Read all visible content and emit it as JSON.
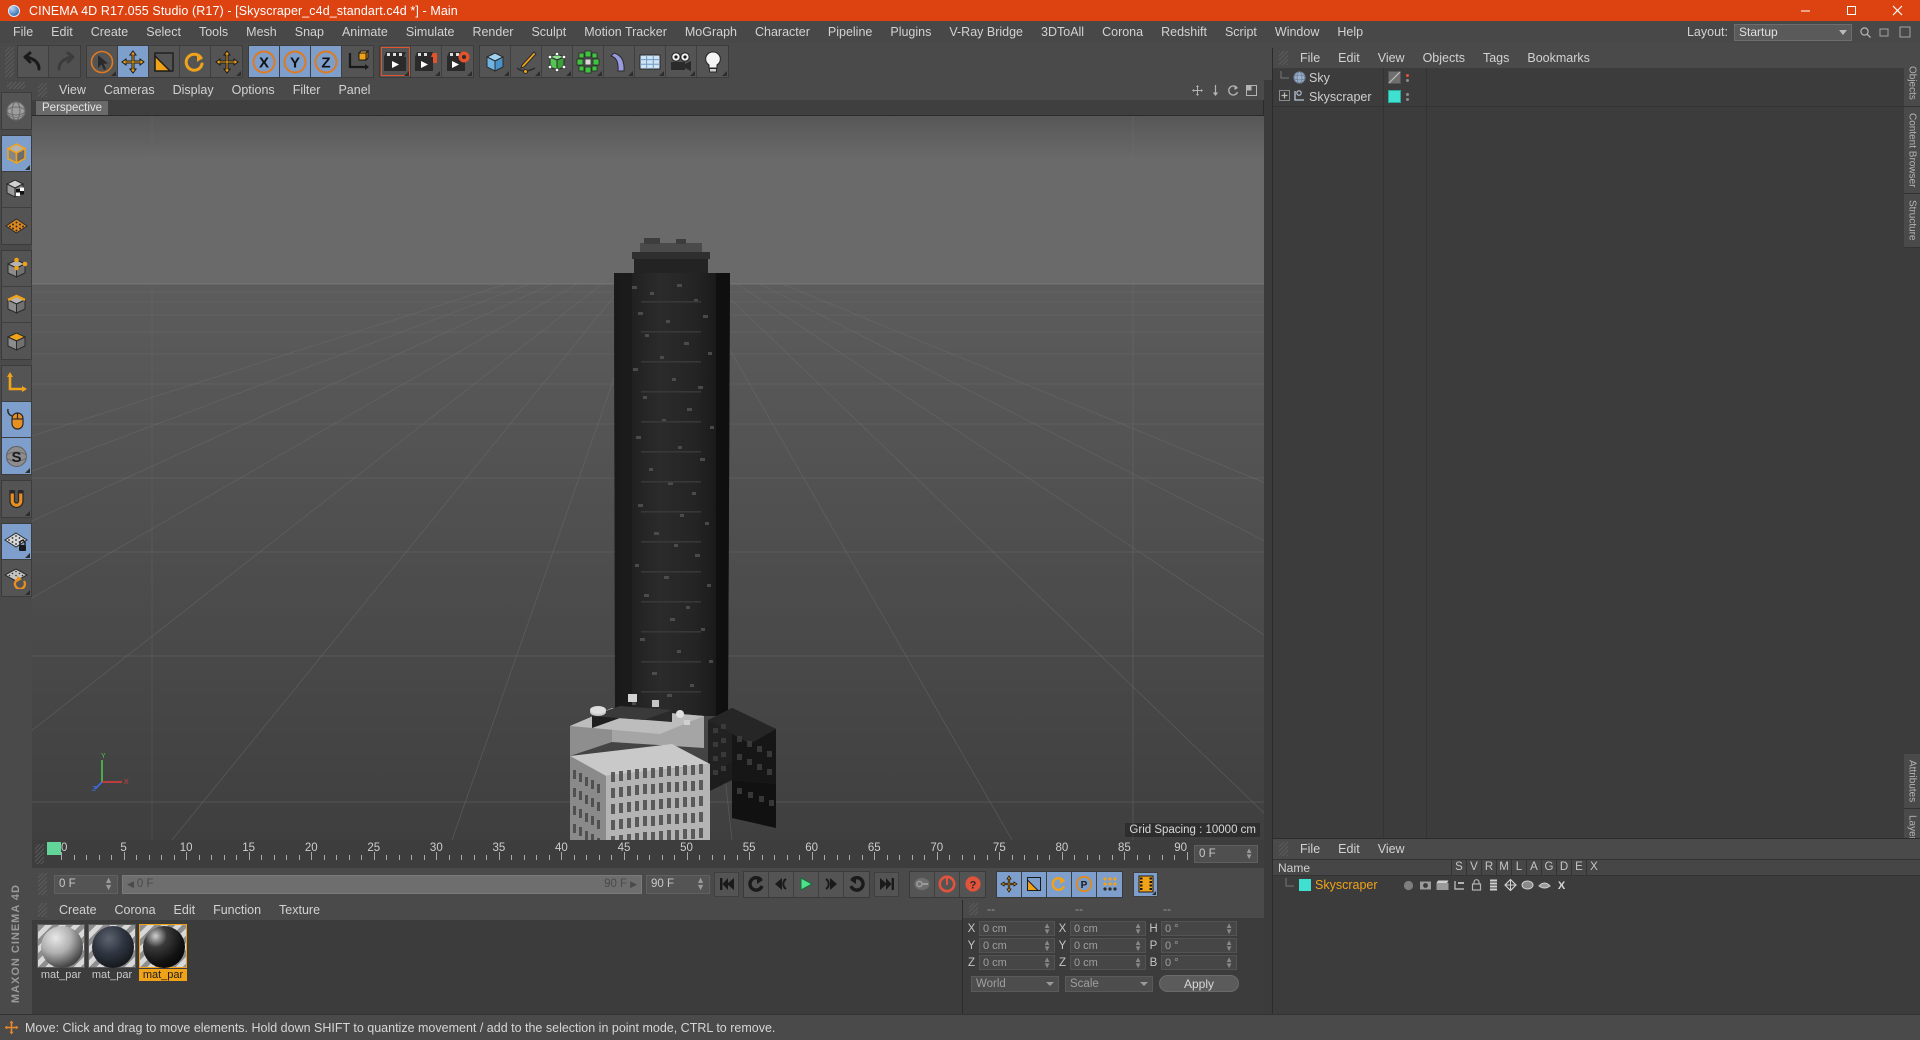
{
  "window": {
    "title": "CINEMA 4D R17.055 Studio (R17) - [Skyscraper_c4d_standart.c4d *] - Main",
    "app_icon": "cinema4d-globe-icon",
    "minimize": "—",
    "maximize": "□",
    "close": "✕"
  },
  "menubar": {
    "items": [
      {
        "label": "File"
      },
      {
        "label": "Edit"
      },
      {
        "label": "Create"
      },
      {
        "label": "Select"
      },
      {
        "label": "Tools"
      },
      {
        "label": "Mesh"
      },
      {
        "label": "Snap"
      },
      {
        "label": "Animate"
      },
      {
        "label": "Simulate"
      },
      {
        "label": "Render"
      },
      {
        "label": "Sculpt"
      },
      {
        "label": "Motion Tracker"
      },
      {
        "label": "MoGraph"
      },
      {
        "label": "Character"
      },
      {
        "label": "Pipeline"
      },
      {
        "label": "Plugins"
      },
      {
        "label": "V-Ray Bridge"
      },
      {
        "label": "3DToAll"
      },
      {
        "label": "Corona"
      },
      {
        "label": "Redshift"
      },
      {
        "label": "Script"
      },
      {
        "label": "Window"
      },
      {
        "label": "Help"
      }
    ],
    "layout_label": "Layout:",
    "layout_value": "Startup",
    "search_icon": "search-icon"
  },
  "toolbar": {
    "groups": [
      {
        "name": "history",
        "buttons": [
          {
            "name": "undo-button",
            "icon": "undo-arrow-icon",
            "selected": false,
            "dim": false
          },
          {
            "name": "redo-button",
            "icon": "redo-arrow-icon",
            "selected": false,
            "dim": true
          }
        ]
      },
      {
        "name": "transform",
        "buttons": [
          {
            "name": "select-tool-button",
            "icon": "cursor-circle-icon",
            "selected": false,
            "dim": false
          },
          {
            "name": "move-tool-button",
            "icon": "move-arrows-icon",
            "selected": true,
            "dim": false
          },
          {
            "name": "scale-tool-button",
            "icon": "scale-box-icon",
            "selected": false,
            "dim": false
          },
          {
            "name": "rotate-tool-button",
            "icon": "rotate-circle-icon",
            "selected": false,
            "dim": false
          },
          {
            "name": "move-duplicate-button",
            "icon": "move-arrows-icon",
            "selected": false,
            "dim": false
          }
        ]
      },
      {
        "name": "axis-locks",
        "buttons": [
          {
            "name": "lock-x-axis-button",
            "icon": "x-axis-icon",
            "selected": true,
            "dim": false
          },
          {
            "name": "lock-y-axis-button",
            "icon": "y-axis-icon",
            "selected": true,
            "dim": false
          },
          {
            "name": "lock-z-axis-button",
            "icon": "z-axis-icon",
            "selected": true,
            "dim": false
          },
          {
            "name": "world-coordinate-button",
            "icon": "world-axis-cube-icon",
            "selected": false,
            "dim": false
          }
        ]
      },
      {
        "name": "render",
        "buttons": [
          {
            "name": "render-view-button",
            "icon": "clapper-play-icon",
            "selected": false,
            "dim": false
          },
          {
            "name": "render-region-button",
            "icon": "clapper-region-icon",
            "selected": false,
            "dim": false
          },
          {
            "name": "render-settings-button",
            "icon": "clapper-gear-icon",
            "selected": false,
            "dim": false
          }
        ]
      },
      {
        "name": "objects",
        "buttons": [
          {
            "name": "add-cube-button",
            "icon": "blue-cube-icon",
            "selected": false,
            "dim": false
          },
          {
            "name": "add-spline-button",
            "icon": "pen-spline-icon",
            "selected": false,
            "dim": false
          },
          {
            "name": "add-generator-button",
            "icon": "green-cube-icon",
            "selected": false,
            "dim": false
          },
          {
            "name": "add-mograph-button",
            "icon": "mograph-cloner-icon",
            "selected": false,
            "dim": false
          },
          {
            "name": "add-deformer-button",
            "icon": "bend-deformer-icon",
            "selected": false,
            "dim": false
          },
          {
            "name": "add-scene-button",
            "icon": "floor-grid-icon",
            "selected": false,
            "dim": false
          },
          {
            "name": "add-camera-button",
            "icon": "camera-icon",
            "selected": false,
            "dim": false
          },
          {
            "name": "add-light-button",
            "icon": "light-bulb-icon",
            "selected": false,
            "dim": false
          }
        ]
      }
    ]
  },
  "left_palette": {
    "groups": [
      {
        "buttons": [
          {
            "name": "undo-view-button",
            "icon": "globe-wireframe-icon",
            "selected": false
          }
        ]
      },
      {
        "buttons": [
          {
            "name": "model-mode-button",
            "icon": "model-cube-icon",
            "selected": true
          },
          {
            "name": "texture-mode-button",
            "icon": "texture-cube-icon",
            "selected": false
          },
          {
            "name": "workplane-mode-button",
            "icon": "workplane-grid-icon",
            "selected": false
          }
        ]
      },
      {
        "buttons": [
          {
            "name": "points-mode-button",
            "icon": "point-cube-icon",
            "selected": false
          },
          {
            "name": "edges-mode-button",
            "icon": "edge-cube-icon",
            "selected": false
          },
          {
            "name": "polygons-mode-button",
            "icon": "polygon-cube-icon",
            "selected": false
          }
        ]
      },
      {
        "buttons": [
          {
            "name": "axis-mode-button",
            "icon": "axis-arrows-icon",
            "selected": false
          },
          {
            "name": "viewport-solo-button",
            "icon": "mouse-icon",
            "selected": true
          },
          {
            "name": "soft-selection-button",
            "icon": "s-disc-icon",
            "selected": true
          }
        ]
      },
      {
        "buttons": [
          {
            "name": "magnet-button",
            "icon": "magnet-icon",
            "selected": false
          }
        ]
      },
      {
        "buttons": [
          {
            "name": "workplane-lock-button",
            "icon": "grid-lock-icon",
            "selected": true
          },
          {
            "name": "workplane-rotate-button",
            "icon": "grid-rotate-icon",
            "selected": false
          }
        ]
      }
    ],
    "brand_text": "MAXON CINEMA 4D"
  },
  "viewport": {
    "menu": [
      {
        "label": "View"
      },
      {
        "label": "Cameras"
      },
      {
        "label": "Display"
      },
      {
        "label": "Options"
      },
      {
        "label": "Filter"
      },
      {
        "label": "Panel"
      }
    ],
    "tab_label": "Perspective",
    "grid_spacing": "Grid Spacing : 10000 cm",
    "axis": {
      "x": "X",
      "y": "Y",
      "z": "Z"
    },
    "corner_icons": [
      "pan-icon",
      "move-y-icon",
      "rotate-icon",
      "maximize-view-icon"
    ]
  },
  "object_manager": {
    "menu": [
      {
        "label": "File"
      },
      {
        "label": "Edit"
      },
      {
        "label": "View"
      },
      {
        "label": "Objects"
      },
      {
        "label": "Tags"
      },
      {
        "label": "Bookmarks"
      }
    ],
    "rows": [
      {
        "name": "Sky",
        "icon": "sky-sphere-icon",
        "tag_color": "#6f6f6f",
        "has_expand": false,
        "dot_red": true
      },
      {
        "name": "Skyscraper",
        "icon": "null-object-icon",
        "tag_color": "#3fe0d0",
        "has_expand": true,
        "dot_red": false
      }
    ]
  },
  "edge_tabs_top": [
    {
      "label": "Objects"
    },
    {
      "label": "Content Browser"
    },
    {
      "label": "Structure"
    }
  ],
  "edge_tabs_bottom": [
    {
      "label": "Attributes"
    },
    {
      "label": "Layers"
    }
  ],
  "timeline": {
    "labels": [
      "0",
      "5",
      "10",
      "15",
      "20",
      "25",
      "30",
      "35",
      "40",
      "45",
      "50",
      "55",
      "60",
      "65",
      "70",
      "75",
      "80",
      "85",
      "90"
    ],
    "frame_value": "0 F",
    "start_marker": "0"
  },
  "playbar": {
    "current_frame": "0 F",
    "range_start": "0 F",
    "range_end": "90 F",
    "end_frame": "90 F",
    "buttons": [
      {
        "name": "go-to-start-button",
        "icon": "skip-start-icon",
        "selected": false
      },
      {
        "name": "step-back-keyframe-button",
        "icon": "prev-key-icon",
        "selected": false
      },
      {
        "name": "play-backwards-button",
        "icon": "play-back-icon",
        "selected": false
      },
      {
        "name": "play-button",
        "icon": "play-icon",
        "selected": false
      },
      {
        "name": "play-forward-button",
        "icon": "play-forward-icon",
        "selected": false
      },
      {
        "name": "next-key-button",
        "icon": "next-key-icon",
        "selected": false
      },
      {
        "name": "go-to-end-button",
        "icon": "skip-end-icon",
        "selected": false
      },
      {
        "name": "record-active-objects-button",
        "icon": "key-icon",
        "selected": false
      },
      {
        "name": "autokeying-button",
        "icon": "autokey-circle-icon",
        "selected": false
      },
      {
        "name": "keyframe-selection-button",
        "icon": "question-circle-icon",
        "selected": false
      },
      {
        "name": "position-key-button",
        "icon": "move-arrows-icon",
        "selected": true
      },
      {
        "name": "scale-key-button",
        "icon": "scale-box-icon",
        "selected": true
      },
      {
        "name": "rotation-key-button",
        "icon": "rotate-circle-icon",
        "selected": true
      },
      {
        "name": "param-key-button",
        "icon": "p-circle-icon",
        "selected": true
      },
      {
        "name": "point-level-anim-button",
        "icon": "pla-dots-icon",
        "selected": true
      },
      {
        "name": "timeline-button",
        "icon": "filmstrip-icon",
        "selected": true
      }
    ]
  },
  "material_manager": {
    "menu": [
      {
        "label": "Create"
      },
      {
        "label": "Corona"
      },
      {
        "label": "Edit"
      },
      {
        "label": "Function"
      },
      {
        "label": "Texture"
      }
    ],
    "materials": [
      {
        "name": "mat_par",
        "selected": false,
        "color_a": "#c9c9c9",
        "color_b": "#6a6a6a"
      },
      {
        "name": "mat_par",
        "selected": false,
        "color_a": "#3c4048",
        "color_b": "#101216"
      },
      {
        "name": "mat_par",
        "selected": true,
        "color_a": "#2a2a2a",
        "color_b": "#050505"
      }
    ]
  },
  "coordinates": {
    "headers": [
      "--",
      "--",
      "--"
    ],
    "rows": [
      {
        "label_pos": "X",
        "value_pos": "0 cm",
        "label_size": "X",
        "value_size": "0 cm",
        "label_rot": "H",
        "value_rot": "0 °"
      },
      {
        "label_pos": "Y",
        "value_pos": "0 cm",
        "label_size": "Y",
        "value_size": "0 cm",
        "label_rot": "P",
        "value_rot": "0 °"
      },
      {
        "label_pos": "Z",
        "value_pos": "0 cm",
        "label_size": "Z",
        "value_size": "0 cm",
        "label_rot": "B",
        "value_rot": "0 °"
      }
    ],
    "system_value": "World",
    "mode_value": "Scale",
    "apply_label": "Apply"
  },
  "attribute_manager": {
    "menu": [
      {
        "label": "File"
      },
      {
        "label": "Edit"
      },
      {
        "label": "View"
      }
    ],
    "columns": [
      "Name",
      "S",
      "V",
      "R",
      "M",
      "L",
      "A",
      "G",
      "D",
      "E",
      "X"
    ],
    "row": {
      "name": "Skyscraper",
      "color": "#3fe0d0"
    }
  },
  "statusbar": {
    "icon": "move-tool-icon",
    "text": "Move: Click and drag to move elements. Hold down SHIFT to quantize movement / add to the selection in point mode, CTRL to remove."
  },
  "colors": {
    "titlebar": "#dd4211",
    "accent_orange": "#f0a319",
    "selected_blue": "#7e9ecb",
    "panel_bg": "#3c3c3c",
    "toolbar_bg": "#4a4a4a",
    "teal_tag": "#3fe0d0",
    "green_marker": "#62d699"
  }
}
